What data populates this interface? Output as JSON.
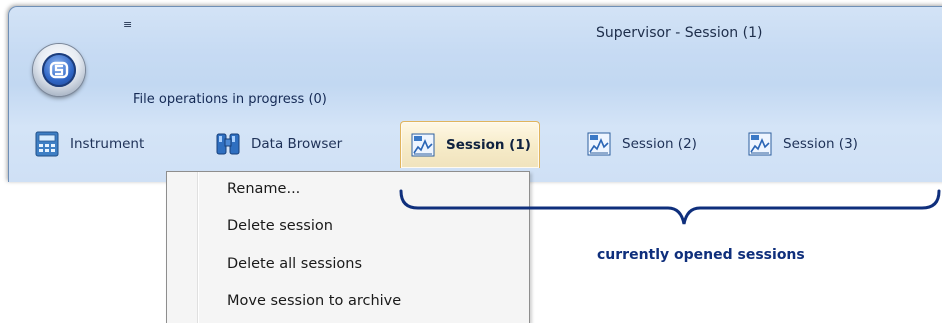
{
  "window": {
    "title": "Supervisor - Session (1)",
    "quick_access_arrow": "≡",
    "file_operations": "File operations in progress (0)"
  },
  "tabs": [
    {
      "label": "Instrument",
      "icon": "instrument-icon",
      "active": false
    },
    {
      "label": "Data Browser",
      "icon": "binoculars-icon",
      "active": false
    },
    {
      "label": "Session (1)",
      "icon": "session-icon",
      "active": true
    },
    {
      "label": "Session (2)",
      "icon": "session-icon",
      "active": false
    },
    {
      "label": "Session (3)",
      "icon": "session-icon",
      "active": false
    }
  ],
  "context_menu": {
    "items": [
      "Rename...",
      "Delete session",
      "Delete all sessions",
      "Move session to archive"
    ]
  },
  "annotation": {
    "label": "currently opened sessions",
    "color": "#0f2f7c"
  }
}
